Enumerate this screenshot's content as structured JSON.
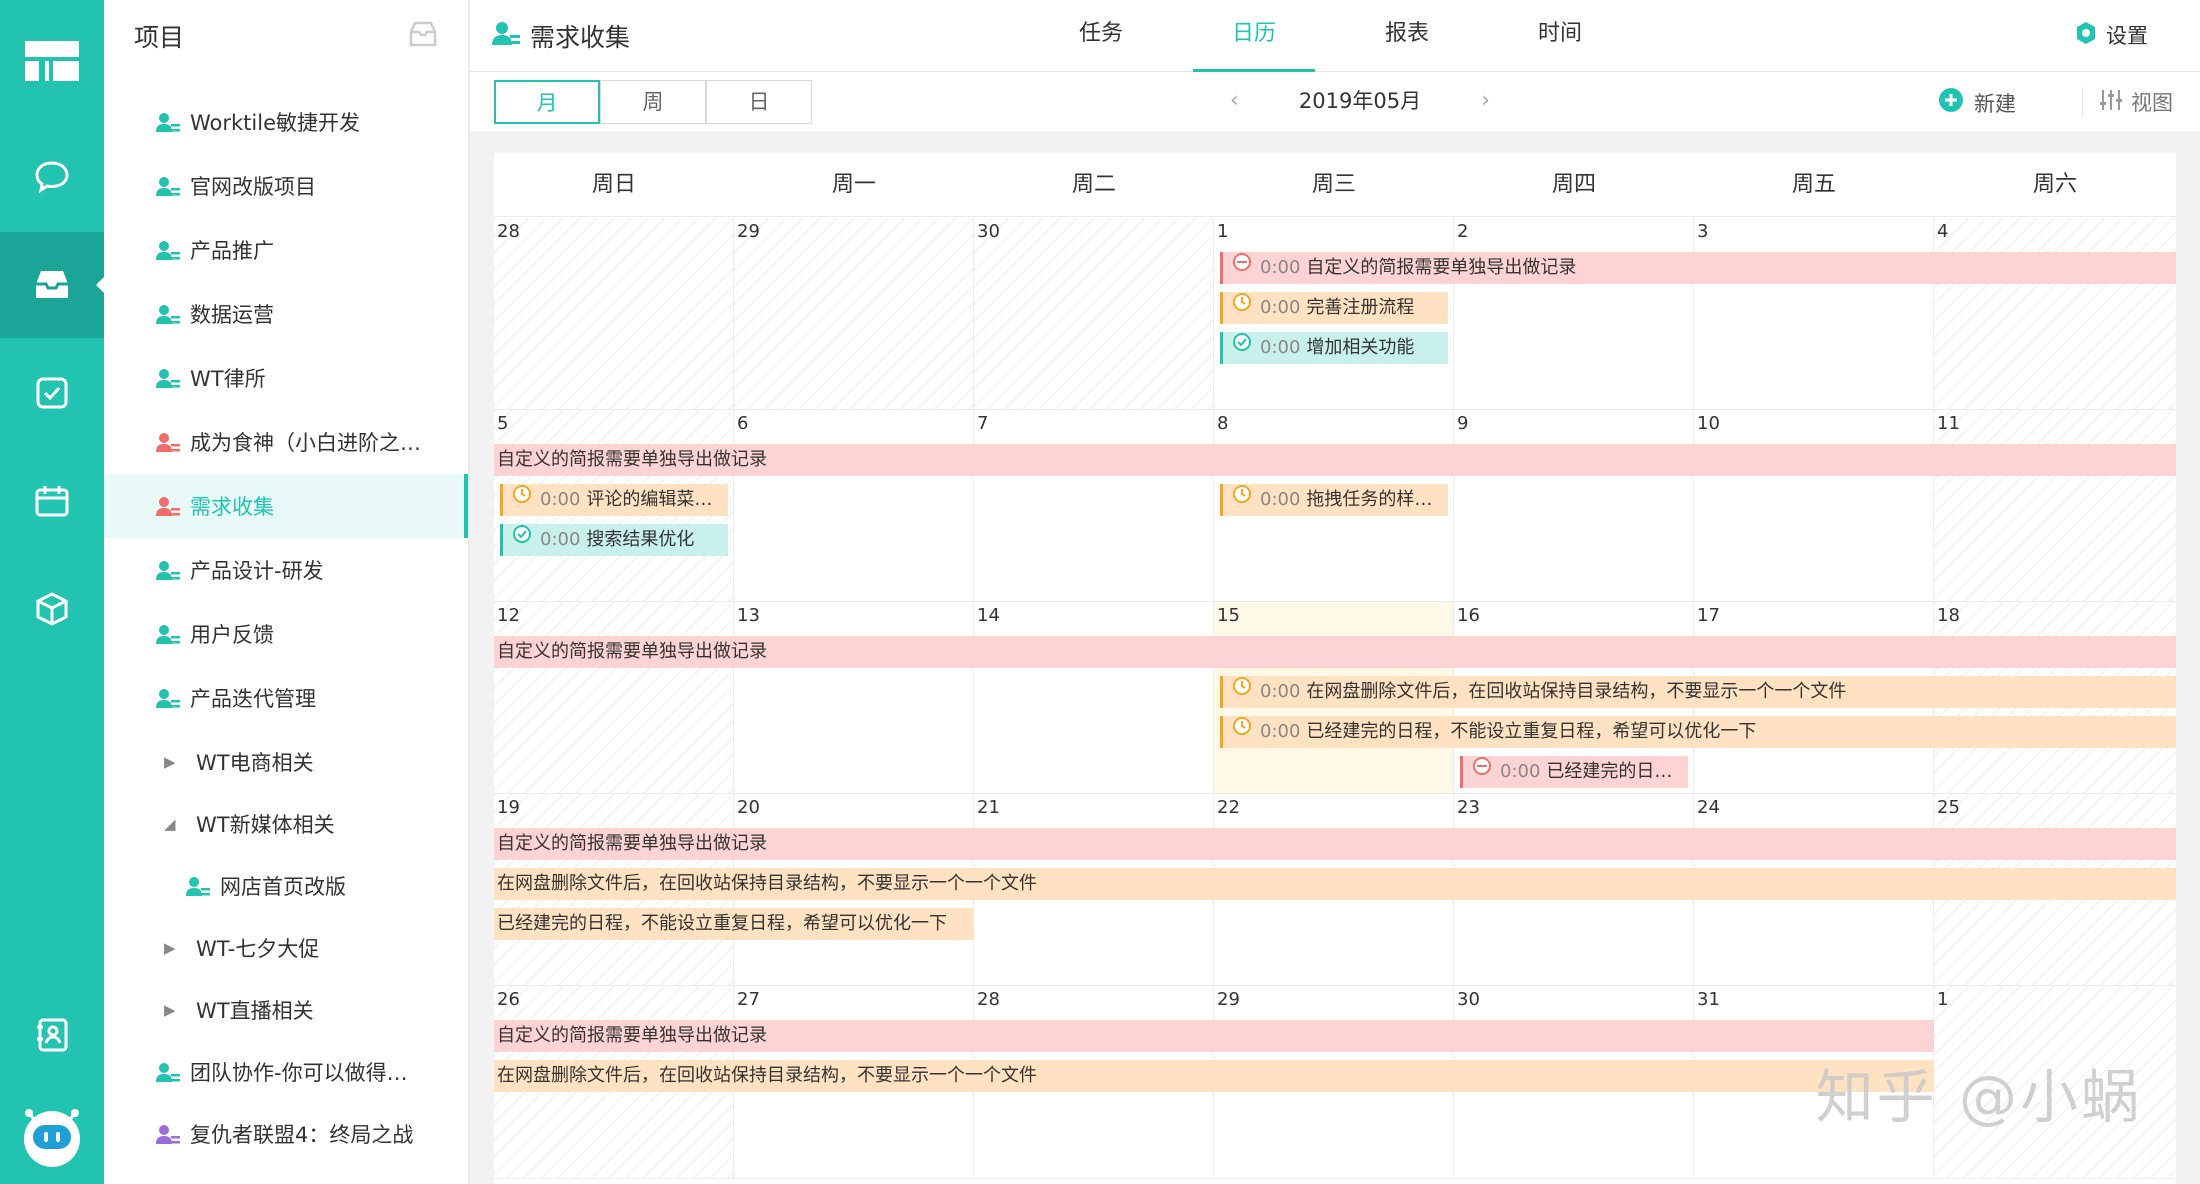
{
  "app": {
    "accent": "#22c3b1"
  },
  "rail": {
    "items": [
      "dashboard-icon",
      "chat-icon",
      "inbox-icon",
      "task-check-icon",
      "calendar-icon",
      "package-icon",
      "contacts-icon",
      "robot-icon"
    ]
  },
  "sidebar": {
    "title": "项目",
    "items": [
      {
        "label": "Worktile敏捷开发",
        "type": "project",
        "color": "#22c3b1"
      },
      {
        "label": "官网改版项目",
        "type": "project",
        "color": "#22c3b1"
      },
      {
        "label": "产品推广",
        "type": "project",
        "color": "#22c3b1"
      },
      {
        "label": "数据运营",
        "type": "project",
        "color": "#22c3b1"
      },
      {
        "label": "WT律所",
        "type": "project",
        "color": "#22c3b1"
      },
      {
        "label": "成为食神（小白进阶之…",
        "type": "project",
        "color": "#f26c6c"
      },
      {
        "label": "需求收集",
        "type": "project",
        "color": "#f26c6c",
        "active": true
      },
      {
        "label": "产品设计-研发",
        "type": "project",
        "color": "#22c3b1"
      },
      {
        "label": "用户反馈",
        "type": "project",
        "color": "#22c3b1"
      },
      {
        "label": "产品迭代管理",
        "type": "project",
        "color": "#22c3b1"
      },
      {
        "label": "WT电商相关",
        "type": "group",
        "expanded": false
      },
      {
        "label": "WT新媒体相关",
        "type": "group",
        "expanded": true
      },
      {
        "label": "网店首页改版",
        "type": "sub",
        "color": "#22c3b1"
      },
      {
        "label": "WT-七夕大促",
        "type": "group",
        "expanded": false
      },
      {
        "label": "WT直播相关",
        "type": "group",
        "expanded": false
      },
      {
        "label": "团队协作-你可以做得…",
        "type": "project",
        "color": "#22c3b1"
      },
      {
        "label": "复仇者联盟4：终局之战",
        "type": "project",
        "color": "#9b6dd6"
      }
    ]
  },
  "header": {
    "title": "需求收集",
    "tabs": [
      {
        "label": "任务",
        "active": false
      },
      {
        "label": "日历",
        "active": true
      },
      {
        "label": "报表",
        "active": false
      },
      {
        "label": "时间",
        "active": false
      }
    ],
    "settings_label": "设置"
  },
  "toolbar": {
    "view_tabs": [
      {
        "label": "月",
        "active": true
      },
      {
        "label": "周",
        "active": false
      },
      {
        "label": "日",
        "active": false
      }
    ],
    "month_label": "2019年05月",
    "new_label": "新建",
    "view_label": "视图"
  },
  "calendar": {
    "weekdays": [
      "周日",
      "周一",
      "周二",
      "周三",
      "周四",
      "周五",
      "周六"
    ],
    "today": {
      "week": 2,
      "col": 3
    },
    "weeks": [
      {
        "days": [
          "28",
          "29",
          "30",
          "1",
          "2",
          "3",
          "4"
        ],
        "outside": [
          0,
          1,
          2
        ],
        "events": [
          {
            "start": 3,
            "span": 4,
            "slot": 0,
            "status": "red",
            "icon": "minus",
            "time": "0:00",
            "text": "自定义的简报需要单独导出做记录"
          },
          {
            "start": 3,
            "span": 1,
            "slot": 1,
            "status": "orange",
            "icon": "clock",
            "time": "0:00",
            "text": "完善注册流程"
          },
          {
            "start": 3,
            "span": 1,
            "slot": 2,
            "status": "teal",
            "icon": "check",
            "time": "0:00",
            "text": "增加相关功能"
          }
        ]
      },
      {
        "days": [
          "5",
          "6",
          "7",
          "8",
          "9",
          "10",
          "11"
        ],
        "outside": [],
        "events": [
          {
            "start": 0,
            "span": 7,
            "slot": 0,
            "status": "red",
            "plain": true,
            "text": "自定义的简报需要单独导出做记录"
          },
          {
            "start": 0,
            "span": 1,
            "slot": 1,
            "status": "orange",
            "icon": "clock",
            "time": "0:00",
            "text": "评论的编辑菜…"
          },
          {
            "start": 3,
            "span": 1,
            "slot": 1,
            "status": "orange",
            "icon": "clock",
            "time": "0:00",
            "text": "拖拽任务的样…"
          },
          {
            "start": 0,
            "span": 1,
            "slot": 2,
            "status": "teal",
            "icon": "check",
            "time": "0:00",
            "text": "搜索结果优化"
          }
        ]
      },
      {
        "days": [
          "12",
          "13",
          "14",
          "15",
          "16",
          "17",
          "18"
        ],
        "outside": [],
        "events": [
          {
            "start": 0,
            "span": 7,
            "slot": 0,
            "status": "red",
            "plain": true,
            "text": "自定义的简报需要单独导出做记录"
          },
          {
            "start": 3,
            "span": 4,
            "slot": 1,
            "status": "orange",
            "icon": "clock",
            "time": "0:00",
            "text": "在网盘删除文件后，在回收站保持目录结构，不要显示一个一个文件"
          },
          {
            "start": 3,
            "span": 4,
            "slot": 2,
            "status": "orange",
            "icon": "clock",
            "time": "0:00",
            "text": "已经建完的日程，不能设立重复日程，希望可以优化一下"
          },
          {
            "start": 4,
            "span": 1,
            "slot": 3,
            "status": "red",
            "icon": "minus",
            "time": "0:00",
            "text": "已经建完的日…"
          }
        ]
      },
      {
        "days": [
          "19",
          "20",
          "21",
          "22",
          "23",
          "24",
          "25"
        ],
        "outside": [],
        "events": [
          {
            "start": 0,
            "span": 7,
            "slot": 0,
            "status": "red",
            "plain": true,
            "text": "自定义的简报需要单独导出做记录"
          },
          {
            "start": 0,
            "span": 7,
            "slot": 1,
            "status": "orange",
            "plain": true,
            "text": "在网盘删除文件后，在回收站保持目录结构，不要显示一个一个文件"
          },
          {
            "start": 0,
            "span": 2,
            "slot": 2,
            "status": "orange",
            "plain": true,
            "text": "已经建完的日程，不能设立重复日程，希望可以优化一下"
          }
        ]
      },
      {
        "days": [
          "26",
          "27",
          "28",
          "29",
          "30",
          "31",
          "1"
        ],
        "outside": [
          6
        ],
        "events": [
          {
            "start": 0,
            "span": 6,
            "slot": 0,
            "status": "red",
            "plain": true,
            "text": "自定义的简报需要单独导出做记录"
          },
          {
            "start": 0,
            "span": 6,
            "slot": 1,
            "status": "orange",
            "plain": true,
            "text": "在网盘删除文件后，在回收站保持目录结构，不要显示一个一个文件"
          }
        ]
      }
    ]
  },
  "watermark": "知乎 @小蜗"
}
